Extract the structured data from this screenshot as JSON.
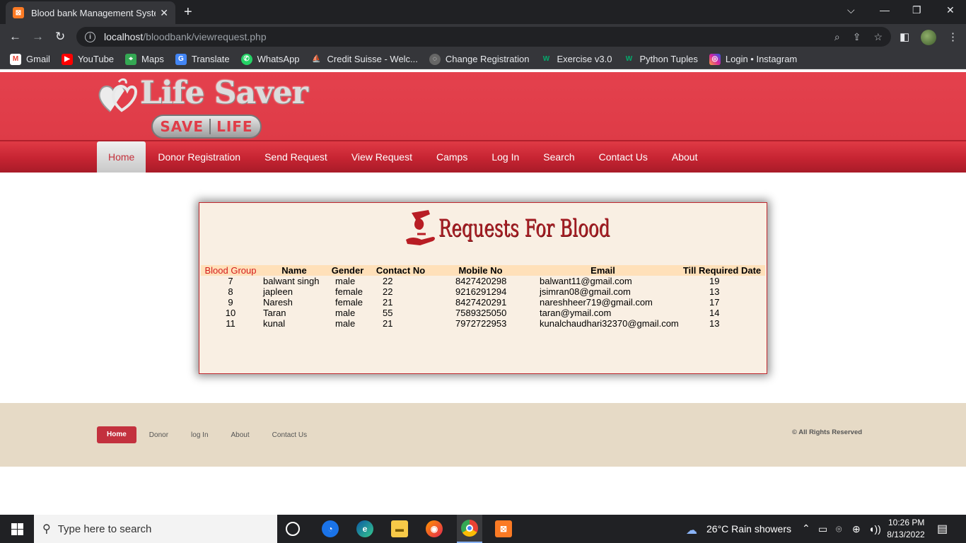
{
  "browser": {
    "tab_title": "Blood bank Management System",
    "tab_favicon": "xampp-icon",
    "url_host": "localhost",
    "url_path": "/bloodbank/viewrequest.php",
    "bookmarks": [
      {
        "label": "Gmail",
        "icon": "gmail-icon",
        "color": "#ea4335"
      },
      {
        "label": "YouTube",
        "icon": "youtube-icon",
        "color": "#ff0000"
      },
      {
        "label": "Maps",
        "icon": "maps-icon",
        "color": "#34a853"
      },
      {
        "label": "Translate",
        "icon": "translate-icon",
        "color": "#4285f4"
      },
      {
        "label": "WhatsApp",
        "icon": "whatsapp-icon",
        "color": "#25d366"
      },
      {
        "label": "Credit Suisse - Welc...",
        "icon": "credit-suisse-icon",
        "color": "#5b8db8"
      },
      {
        "label": "Change Registration",
        "icon": "globe-icon",
        "color": "#666666"
      },
      {
        "label": "Exercise v3.0",
        "icon": "w3schools-icon",
        "color": "#04aa6d"
      },
      {
        "label": "Python Tuples",
        "icon": "w3schools-icon",
        "color": "#04aa6d"
      },
      {
        "label": "Login • Instagram",
        "icon": "instagram-icon",
        "color": "#d6249f"
      }
    ]
  },
  "site": {
    "logo_title": "Life Saver",
    "logo_save": "SAVE",
    "logo_life": "LIFE",
    "brand_color": "#e1404b",
    "nav": [
      "Home",
      "Donor Registration",
      "Send Request",
      "View Request",
      "Camps",
      "Log In",
      "Search",
      "Contact Us",
      "About"
    ],
    "active_nav": "Home"
  },
  "requests": {
    "heading": "Requests For Blood",
    "columns": [
      "Blood Group",
      "Name",
      "Gender",
      "Contact No",
      "Mobile No",
      "Email",
      "Till Required Date"
    ],
    "rows": [
      [
        "7",
        "balwant singh",
        "male",
        "22",
        "8427420298",
        "balwant11@gmail.com",
        "19"
      ],
      [
        "8",
        "japleen",
        "female",
        "22",
        "9216291294",
        "jsimran08@gmail.com",
        "13"
      ],
      [
        "9",
        "Naresh",
        "female",
        "21",
        "8427420291",
        "nareshheer719@gmail.com",
        "17"
      ],
      [
        "10",
        "Taran",
        "male",
        "55",
        "7589325050",
        "taran@ymail.com",
        "14"
      ],
      [
        "11",
        "kunal",
        "male",
        "21",
        "7972722953",
        "kunalchaudhari32370@gmail.com",
        "13"
      ]
    ]
  },
  "footer": {
    "nav": [
      "Home",
      "Donor",
      "log In",
      "About",
      "Contact Us"
    ],
    "copyright": "© All Rights Reserved"
  },
  "taskbar": {
    "search_placeholder": "Type here to search",
    "weather": "26°C  Rain showers",
    "time": "10:26 PM",
    "date": "8/13/2022"
  }
}
